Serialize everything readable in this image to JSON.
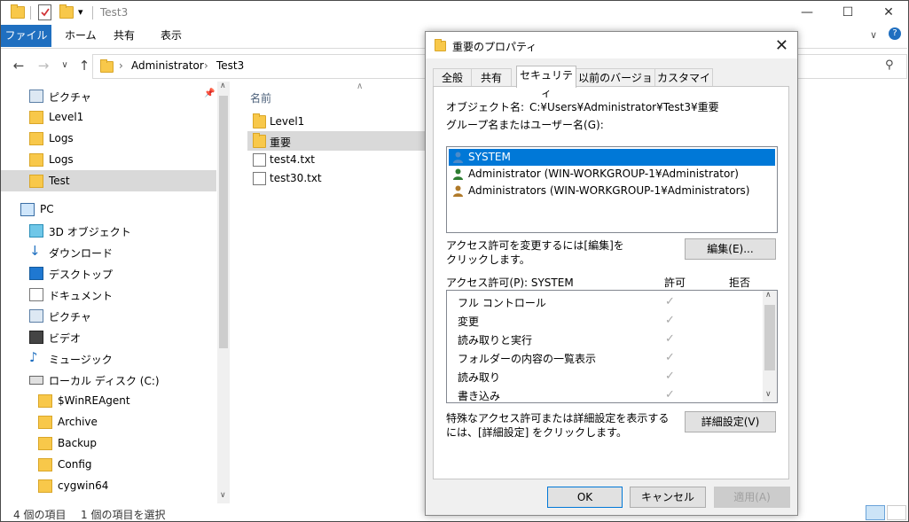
{
  "window": {
    "title": "Test3",
    "minimize_glyph": "—",
    "maximize_glyph": "☐",
    "close_glyph": "✕"
  },
  "ribbon": {
    "file_tab": "ファイル",
    "tabs": [
      "ホーム",
      "共有",
      "表示"
    ]
  },
  "address": {
    "segments": [
      "Administrator",
      "Test3"
    ]
  },
  "nav": {
    "items": [
      {
        "label": "ピクチャ",
        "icon": "pictures-icon"
      },
      {
        "label": "Level1",
        "icon": "folder-icon"
      },
      {
        "label": "Logs",
        "icon": "folder-icon"
      },
      {
        "label": "Logs",
        "icon": "folder-icon"
      },
      {
        "label": "Test",
        "icon": "folder-icon",
        "selected": true
      },
      {
        "label": "PC",
        "icon": "pc-icon"
      },
      {
        "label": "3D オブジェクト",
        "icon": "3d-objects-icon"
      },
      {
        "label": "ダウンロード",
        "icon": "download-icon"
      },
      {
        "label": "デスクトップ",
        "icon": "desktop-icon"
      },
      {
        "label": "ドキュメント",
        "icon": "documents-icon"
      },
      {
        "label": "ピクチャ",
        "icon": "pictures-icon"
      },
      {
        "label": "ビデオ",
        "icon": "videos-icon"
      },
      {
        "label": "ミュージック",
        "icon": "music-icon"
      },
      {
        "label": "ローカル ディスク (C:)",
        "icon": "drive-icon"
      },
      {
        "label": "$WinREAgent",
        "icon": "folder-icon"
      },
      {
        "label": "Archive",
        "icon": "folder-icon"
      },
      {
        "label": "Backup",
        "icon": "folder-icon"
      },
      {
        "label": "Config",
        "icon": "folder-icon"
      },
      {
        "label": "cygwin64",
        "icon": "folder-icon"
      }
    ]
  },
  "filelist": {
    "column_name": "名前",
    "items": [
      {
        "label": "Level1",
        "type": "folder"
      },
      {
        "label": "重要",
        "type": "folder",
        "selected": true
      },
      {
        "label": "test4.txt",
        "type": "file"
      },
      {
        "label": "test30.txt",
        "type": "file"
      }
    ]
  },
  "status": {
    "item_count": "4 個の項目",
    "selected_count": "1 個の項目を選択"
  },
  "dialog": {
    "title": "重要のプロパティ",
    "tabs": [
      "全般",
      "共有",
      "セキュリティ",
      "以前のバージョン",
      "カスタマイズ"
    ],
    "active_tab": "セキュリティ",
    "object_name_label": "オブジェクト名:",
    "object_name_value": "C:¥Users¥Administrator¥Test3¥重要",
    "group_label": "グループ名またはユーザー名(G):",
    "users": [
      {
        "label": "SYSTEM",
        "selected": true
      },
      {
        "label": "Administrator (WIN-WORKGROUP-1¥Administrator)"
      },
      {
        "label": "Administrators (WIN-WORKGROUP-1¥Administrators)"
      }
    ],
    "edit_hint_line1": "アクセス許可を変更するには[編集]を",
    "edit_hint_line2": "クリックします。",
    "edit_button": "編集(E)...",
    "perm_label": "アクセス許可(P): SYSTEM",
    "allow_header": "許可",
    "deny_header": "拒否",
    "permissions": [
      {
        "label": "フル コントロール",
        "allow": true
      },
      {
        "label": "変更",
        "allow": true
      },
      {
        "label": "読み取りと実行",
        "allow": true
      },
      {
        "label": "フォルダーの内容の一覧表示",
        "allow": true
      },
      {
        "label": "読み取り",
        "allow": true
      },
      {
        "label": "書き込み",
        "allow": true
      }
    ],
    "advanced_hint_line1": "特殊なアクセス許可または詳細設定を表示する",
    "advanced_hint_line2": "には、[詳細設定] をクリックします。",
    "advanced_button": "詳細設定(V)",
    "ok_button": "OK",
    "cancel_button": "キャンセル",
    "apply_button": "適用(A)",
    "check_glyph": "✓"
  },
  "colors": {
    "accent": "#1f6fc0",
    "selection": "#0078d7",
    "folder": "#f8c84a"
  }
}
